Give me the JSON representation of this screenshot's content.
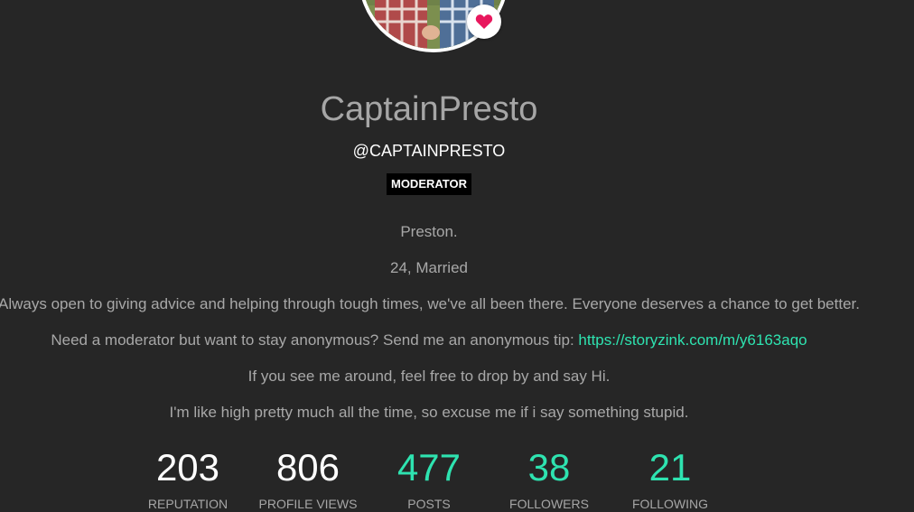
{
  "profile": {
    "display_name": "CaptainPresto",
    "username": "@CAPTAINPRESTO",
    "role_badge": "MODERATOR",
    "bio_lines": [
      "Preston.",
      "24, Married",
      "Always open to giving advice and helping through tough times, we've all been there. Everyone deserves a chance to get better.",
      "Need a moderator but want to stay anonymous? Send me an anonymous tip: ",
      "If you see me around, feel free to drop by and say Hi.",
      "I'm like high pretty much all the time, so excuse me if i say something stupid."
    ],
    "tip_link": "https://storyzink.com/m/y6163aqo"
  },
  "stats": [
    {
      "value": "203",
      "label": "REPUTATION"
    },
    {
      "value": "806",
      "label": "PROFILE VIEWS"
    },
    {
      "value": "477",
      "label": "POSTS"
    },
    {
      "value": "38",
      "label": "FOLLOWERS"
    },
    {
      "value": "21",
      "label": "FOLLOWING"
    }
  ],
  "icons": {
    "badge_icon": "heart-icon"
  },
  "colors": {
    "background": "#262626",
    "accent": "#2ee3b0",
    "heart": "#e8175d",
    "badge_bg": "#000000"
  }
}
